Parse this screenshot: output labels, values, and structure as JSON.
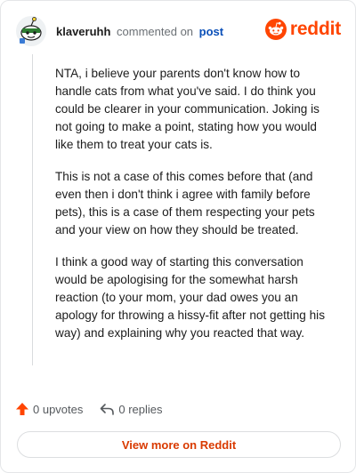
{
  "header": {
    "username": "klaveruhh",
    "verb": "commented on",
    "link_label": "post",
    "brand": "reddit"
  },
  "comment": {
    "paragraphs": [
      "NTA, i believe your parents don't know how to handle cats from what you've said. I do think you could be clearer in your communication. Joking is not going to make a point, stating how you would like them to treat your cats is.",
      "This is not a case of this comes before that (and even then i don't think i agree with family before pets), this is a case of them respecting your pets and your view on how they should be treated.",
      "I think a good way of starting this conversation would be apologising for the somewhat harsh reaction (to your mom, your dad owes you an apology for throwing a hissy-fit after not getting his way) and explaining why you reacted that way."
    ]
  },
  "actions": {
    "upvotes": "0 upvotes",
    "replies": "0 replies"
  },
  "cta": {
    "label": "View more on Reddit"
  },
  "colors": {
    "brand": "#ff4500",
    "link": "#0a4fb8",
    "cta_text": "#d93a00"
  },
  "icons": {
    "avatar": "snoo-avatar",
    "brand": "reddit-snoo-icon",
    "upvote": "upvote-arrow-icon",
    "reply": "reply-arrow-icon"
  }
}
